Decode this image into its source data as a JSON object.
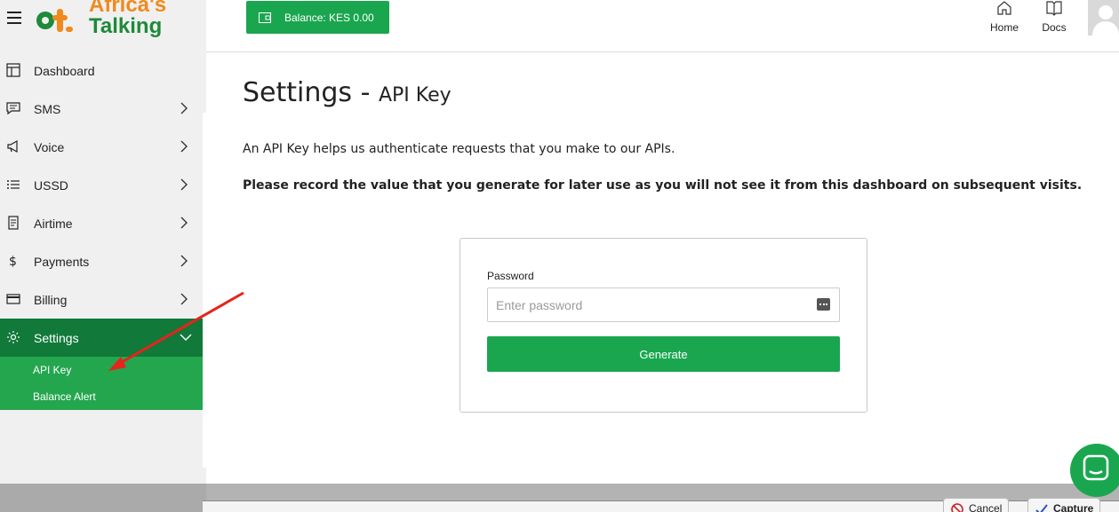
{
  "brand": {
    "line1": "Africa's",
    "line2": "Talking"
  },
  "header": {
    "balance_label": "Balance: KES 0.00",
    "home_label": "Home",
    "docs_label": "Docs"
  },
  "sidebar": {
    "items": [
      {
        "label": "Dashboard",
        "icon": "dashboard-icon"
      },
      {
        "label": "SMS",
        "icon": "message-icon"
      },
      {
        "label": "Voice",
        "icon": "megaphone-icon"
      },
      {
        "label": "USSD",
        "icon": "list-icon"
      },
      {
        "label": "Airtime",
        "icon": "receipt-icon"
      },
      {
        "label": "Payments",
        "icon": "dollar-icon"
      },
      {
        "label": "Billing",
        "icon": "card-icon"
      },
      {
        "label": "Settings",
        "icon": "gear-icon"
      }
    ],
    "subitems": [
      {
        "label": "API Key"
      },
      {
        "label": "Balance Alert"
      }
    ]
  },
  "main": {
    "title": "Settings -",
    "title_sub": "API Key",
    "description": "An API Key helps us authenticate requests that you make to our APIs.",
    "note": "Please record the value that you generate for later use as you will not see it from this dashboard on subsequent visits.",
    "form": {
      "password_label": "Password",
      "password_placeholder": "Enter password",
      "generate_label": "Generate"
    }
  },
  "footer": {
    "cancel_label": "Cancel",
    "capture_label": "Capture"
  },
  "colors": {
    "brand_green": "#1aa64f",
    "active_green": "#11793a",
    "sub_green": "#24a64e",
    "brand_orange": "#f08a1c",
    "arrow_red": "#e8231b"
  }
}
